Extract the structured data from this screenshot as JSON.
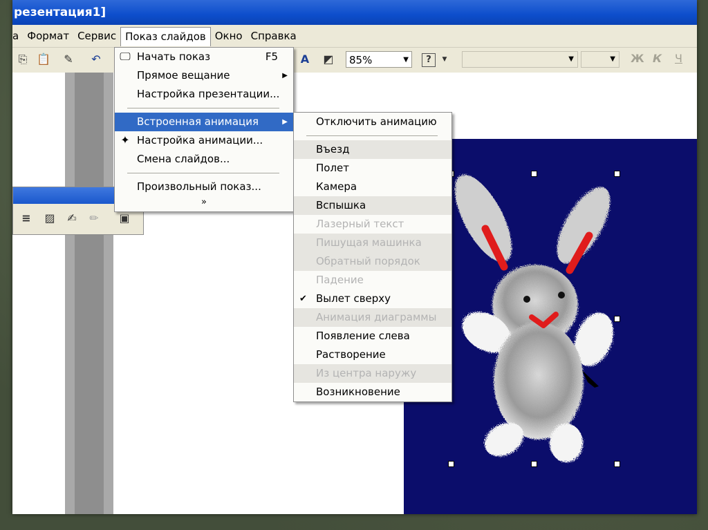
{
  "window": {
    "title": "резентация1]"
  },
  "menubar": {
    "items": [
      {
        "label": "а"
      },
      {
        "label": "Формат"
      },
      {
        "label": "Сервис"
      },
      {
        "label": "Показ слайдов"
      },
      {
        "label": "Окно"
      },
      {
        "label": "Справка"
      }
    ]
  },
  "toolbar": {
    "zoom": "85%"
  },
  "slideshow_menu": {
    "items": [
      {
        "label": "Начать показ",
        "shortcut": "F5",
        "icon": "projector-icon"
      },
      {
        "label": "Прямое вещание",
        "has_submenu": true
      },
      {
        "label": "Настройка презентации..."
      },
      {
        "label": "Встроенная анимация",
        "has_submenu": true,
        "selected": true
      },
      {
        "label": "Настройка анимации...",
        "icon": "animation-icon"
      },
      {
        "label": "Смена слайдов..."
      },
      {
        "label": "Произвольный показ..."
      }
    ],
    "more": "»"
  },
  "animation_submenu": {
    "items": [
      {
        "label": "Отключить анимацию",
        "state": "normal"
      },
      {
        "label": "Въезд",
        "state": "group"
      },
      {
        "label": "Полет",
        "state": "normal"
      },
      {
        "label": "Камера",
        "state": "normal"
      },
      {
        "label": "Вспышка",
        "state": "group"
      },
      {
        "label": "Лазерный текст",
        "state": "disabled"
      },
      {
        "label": "Пишущая машинка",
        "state": "disabled"
      },
      {
        "label": "Обратный порядок",
        "state": "disabled"
      },
      {
        "label": "Падение",
        "state": "disabled"
      },
      {
        "label": "Вылет сверху",
        "state": "checked"
      },
      {
        "label": "Анимация диаграммы",
        "state": "disabled"
      },
      {
        "label": "Появление слева",
        "state": "normal"
      },
      {
        "label": "Растворение",
        "state": "normal"
      },
      {
        "label": "Из центра наружу",
        "state": "disabled"
      },
      {
        "label": "Возникновение",
        "state": "normal"
      }
    ]
  },
  "colors": {
    "titlebar": "#0d4ecc",
    "menu_highlight": "#316ac5",
    "slide_background": "#0b0d6b"
  }
}
